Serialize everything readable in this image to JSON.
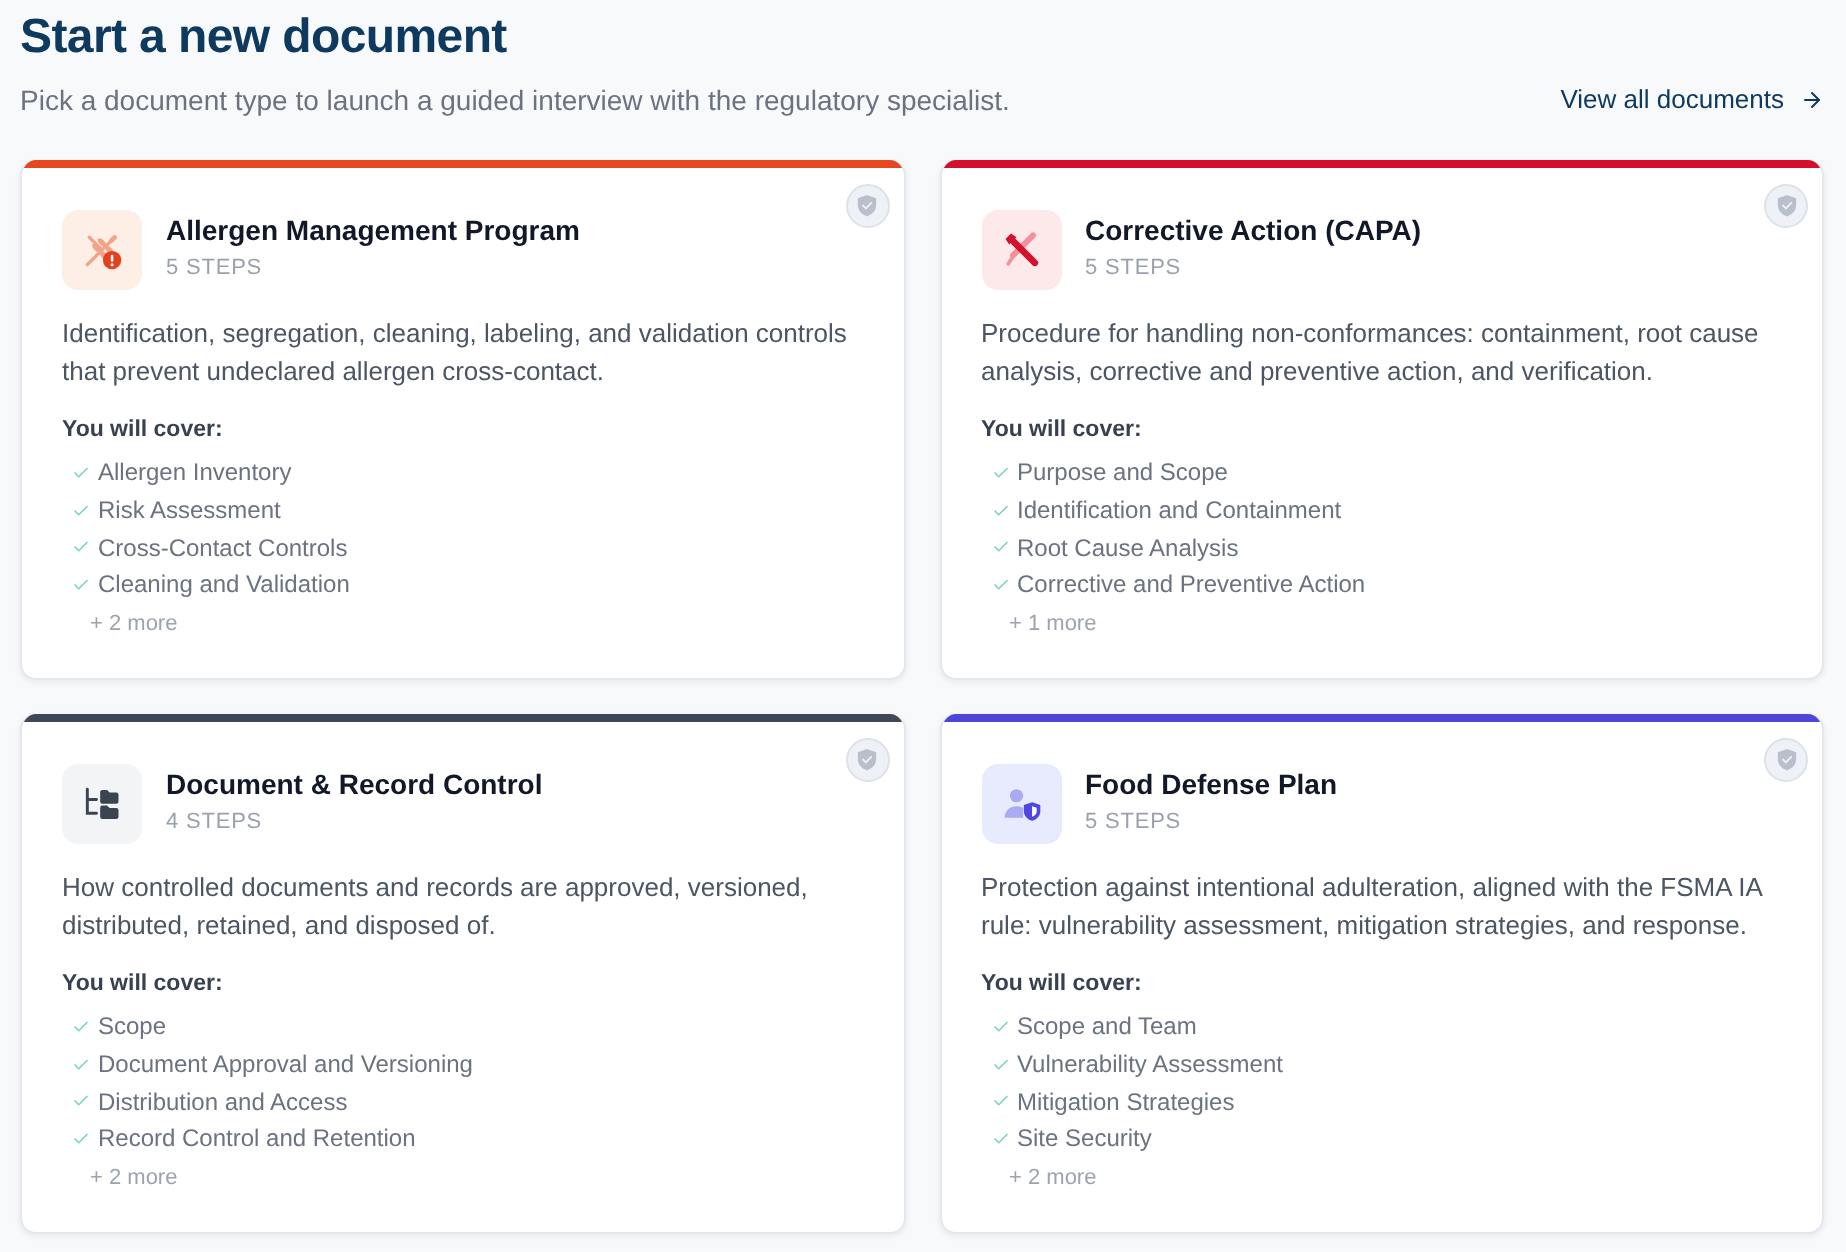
{
  "header": {
    "title": "Start a new document",
    "subtitle": "Pick a document type to launch a guided interview with the regulatory specialist.",
    "link": "View all documents"
  },
  "cards": [
    {
      "kind": "allergen",
      "color": "#e8461e",
      "title": "Allergen Management Program",
      "steps": "5 STEPS",
      "description": "Identification, segregation, cleaning, labeling, and validation controls that prevent undeclared allergen cross-contact.",
      "cover_label": "You will cover:",
      "topics": [
        "Allergen Inventory",
        "Risk Assessment",
        "Cross-Contact Controls",
        "Cleaning and Validation"
      ],
      "more": "+ 2 more"
    },
    {
      "kind": "capa",
      "color": "#d40f2e",
      "title": "Corrective Action (CAPA)",
      "steps": "5 STEPS",
      "description": "Procedure for handling non-conformances: containment, root cause analysis, corrective and preventive action, and verification.",
      "cover_label": "You will cover:",
      "topics": [
        "Purpose and Scope",
        "Identification and Containment",
        "Root Cause Analysis",
        "Corrective and Preventive Action"
      ],
      "more": "+ 1 more"
    },
    {
      "kind": "records",
      "color": "#3f4856",
      "title": "Document & Record Control",
      "steps": "4 STEPS",
      "description": "How controlled documents and records are approved, versioned, distributed, retained, and disposed of.",
      "cover_label": "You will cover:",
      "topics": [
        "Scope",
        "Document Approval and Versioning",
        "Distribution and Access",
        "Record Control and Retention"
      ],
      "more": "+ 2 more"
    },
    {
      "kind": "defense",
      "color": "#4e46dc",
      "title": "Food Defense Plan",
      "steps": "5 STEPS",
      "description": "Protection against intentional adulteration, aligned with the FSMA IA rule: vulnerability assessment, mitigation strategies, and response.",
      "cover_label": "You will cover:",
      "topics": [
        "Scope and Team",
        "Vulnerability Assessment",
        "Mitigation Strategies",
        "Site Security"
      ],
      "more": "+ 2 more"
    }
  ]
}
